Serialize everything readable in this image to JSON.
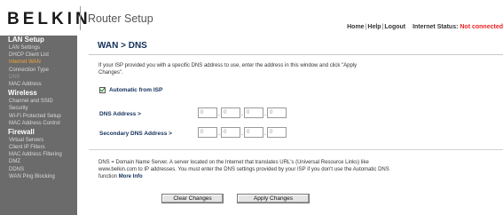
{
  "header": {
    "logo": "BELKIN",
    "app_title": "Router Setup",
    "links": {
      "home": "Home",
      "help": "Help",
      "logout": "Logout",
      "sep": "|"
    },
    "status_label": "Internet Status:",
    "status_value": "Not connected",
    "status_color": "#e22222"
  },
  "sidebar": {
    "lan_setup": {
      "title": "LAN Setup",
      "items": [
        {
          "label": "LAN Settings"
        },
        {
          "label": "DHCP Client List"
        },
        {
          "label": "Internet WAN"
        },
        {
          "label": "Connection Type"
        },
        {
          "label": "DNS"
        },
        {
          "label": "MAC Address"
        }
      ]
    },
    "wireless": {
      "title": "Wireless",
      "items": [
        {
          "label": "Channel and SSID"
        },
        {
          "label": "Security"
        },
        {
          "label": "Wi-Fi Protected Setup"
        },
        {
          "label": "MAC Address Control"
        }
      ]
    },
    "firewall": {
      "title": "Firewall",
      "items": [
        {
          "label": "Virtual Servers"
        },
        {
          "label": "Client IP Filters"
        },
        {
          "label": "MAC Address Filtering"
        },
        {
          "label": "DMZ"
        },
        {
          "label": "DDNS"
        },
        {
          "label": "WAN Ping Blocking"
        }
      ]
    },
    "active_color": "#f2a63a"
  },
  "main": {
    "title": "WAN > DNS",
    "intro": "If your ISP provided you with a specific DNS address to use, enter the address in this window and click \"Apply Changes\".",
    "auto_label": "Automatic from ISP",
    "auto_checked": true,
    "dns_label": "DNS Address >",
    "dns_octets": [
      "0",
      "0",
      "0",
      "0"
    ],
    "secondary_label": "Secondary DNS Address >",
    "secondary_octets": [
      "0",
      "0",
      "0",
      "0"
    ],
    "octet_sep": ".",
    "note": "DNS = Domain Name Server. A server located on the Internet that translates URL's (Universal Resource Links) like www.belkin.com to IP addresses. You must enter the DNS settings provided by your ISP if you don't use the Automatic DNS function",
    "more_info": "More Info",
    "clear_button": "Clear Changes",
    "apply_button": "Apply Changes"
  }
}
